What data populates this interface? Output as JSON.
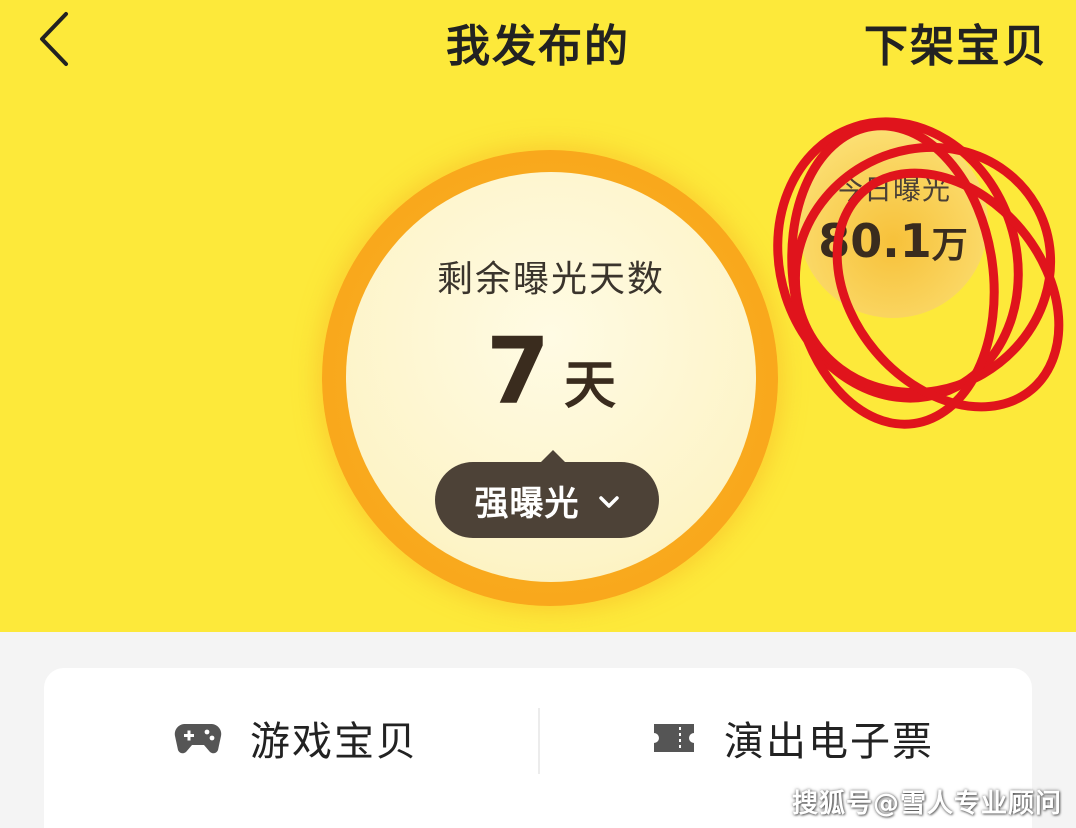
{
  "header": {
    "back_icon": "chevron-left-icon",
    "title": "我发布的",
    "action_label": "下架宝贝"
  },
  "exposure": {
    "remaining_label": "剩余曝光天数",
    "remaining_value": "7",
    "remaining_unit": "天",
    "boost_button_label": "强曝光",
    "boost_button_icon": "chevron-down-icon"
  },
  "today": {
    "label": "今日曝光",
    "value": "80.1",
    "unit": "万"
  },
  "categories": [
    {
      "label": "游戏宝贝",
      "icon": "gamepad-icon"
    },
    {
      "label": "演出电子票",
      "icon": "ticket-icon"
    }
  ],
  "watermark": "搜狐号@雪人专业顾问",
  "colors": {
    "header_bg": "#fde93a",
    "ring": "#f9a81c",
    "disc": "#fdf4c8",
    "pill": "#4d4237",
    "annotation": "#e0141c"
  }
}
